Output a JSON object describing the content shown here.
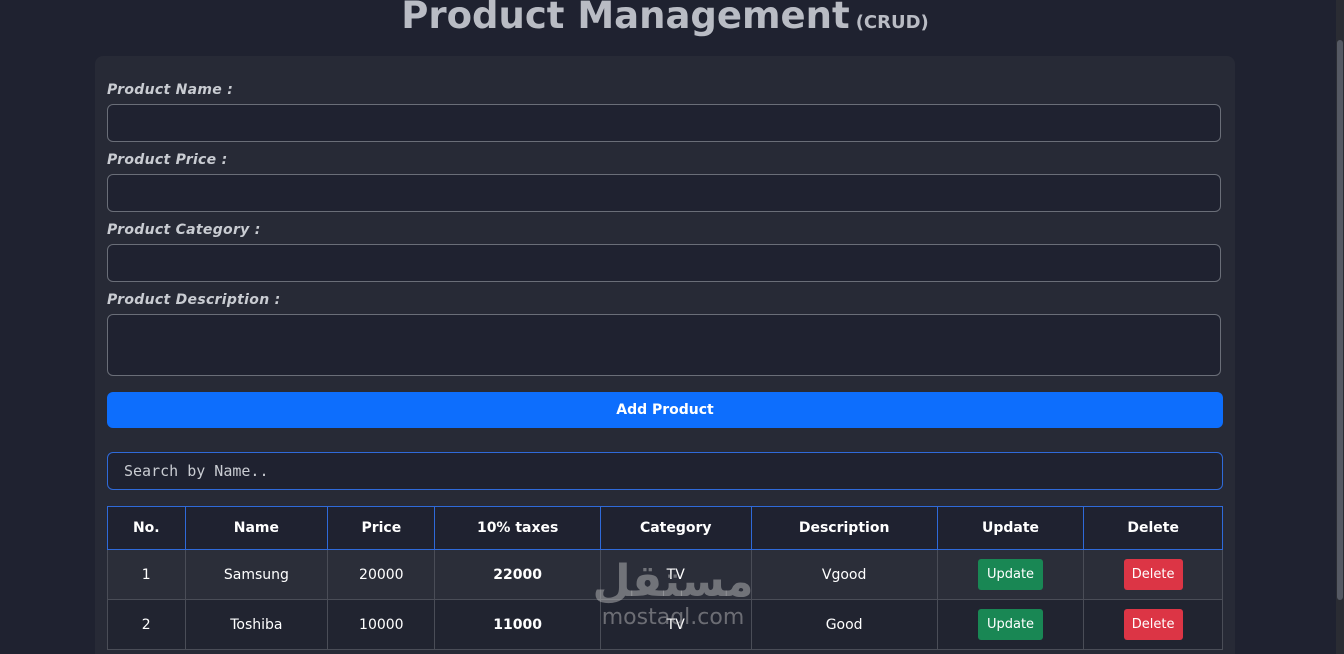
{
  "header": {
    "title": "Product Management",
    "subtitle": "(CRUD)"
  },
  "form": {
    "name_label": "Product Name :",
    "price_label": "Product Price :",
    "category_label": "Product Category :",
    "description_label": "Product Description :",
    "name_value": "",
    "price_value": "",
    "category_value": "",
    "description_value": "",
    "add_button": "Add Product"
  },
  "search": {
    "placeholder": "Search by Name.."
  },
  "table": {
    "headers": [
      "No.",
      "Name",
      "Price",
      "10% taxes",
      "Category",
      "Description",
      "Update",
      "Delete"
    ],
    "rows": [
      {
        "no": "1",
        "name": "Samsung",
        "price": "20000",
        "total": "22000",
        "category": "TV",
        "description": "Vgood",
        "update": "Update",
        "delete": "Delete"
      },
      {
        "no": "2",
        "name": "Toshiba",
        "price": "10000",
        "total": "11000",
        "category": "TV",
        "description": "Good",
        "update": "Update",
        "delete": "Delete"
      }
    ]
  },
  "watermark": {
    "arabic": "مستقل",
    "latin": "mostaql.com"
  },
  "colors": {
    "background": "#1f2230",
    "card": "#272a36",
    "primary": "#0d6efd",
    "success": "#198754",
    "danger": "#dc3545"
  }
}
